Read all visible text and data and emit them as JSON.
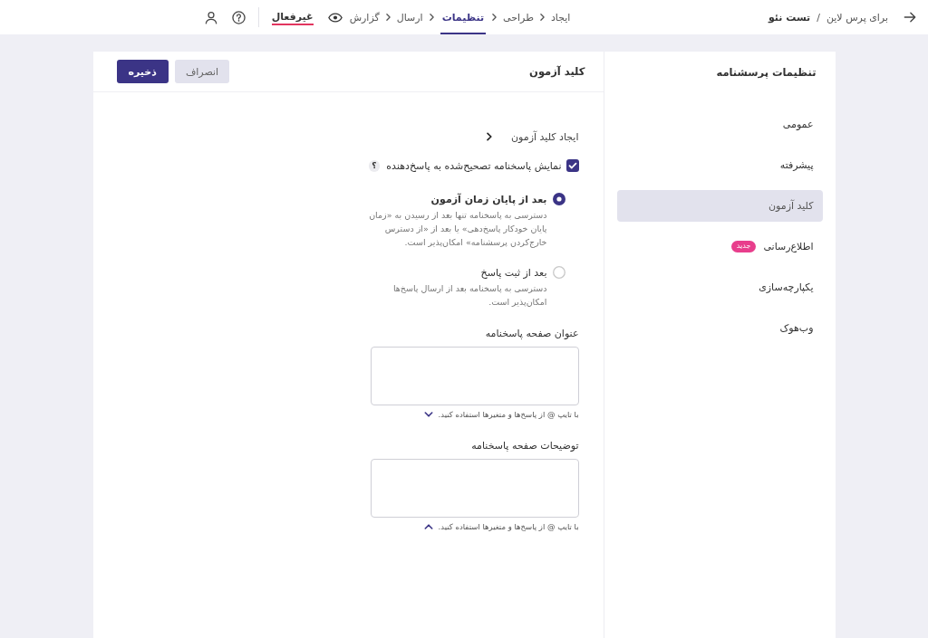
{
  "top_bar": {
    "project": {
      "parent": "برای پرس لاین",
      "separator": "/",
      "name": "تست نئو"
    },
    "steps": [
      {
        "label": "ایجاد",
        "selected": false
      },
      {
        "label": "طراحی",
        "selected": false
      },
      {
        "label": "تنظیمات",
        "selected": true
      },
      {
        "label": "ارسال",
        "selected": false
      },
      {
        "label": "گزارش",
        "selected": false
      }
    ],
    "status": "غیرفعال"
  },
  "sidebar": {
    "title": "تنظیمات پرسشنامه",
    "items": [
      {
        "label": "عمومی",
        "selected": false
      },
      {
        "label": "پیشرفته",
        "selected": false
      },
      {
        "label": "کلید آزمون",
        "selected": true
      },
      {
        "label": "اطلاع‌رسانی",
        "selected": false,
        "badge": "جدید"
      },
      {
        "label": "یکپارچه‌سازی",
        "selected": false
      },
      {
        "label": "وب‌هوک",
        "selected": false
      }
    ]
  },
  "panel": {
    "title": "کلید آزمون",
    "buttons": [
      {
        "label": "انصراف",
        "kind": "secondary"
      },
      {
        "label": "ذخیره",
        "kind": "primary"
      }
    ],
    "section": {
      "label": "ایجاد کلید آزمون"
    },
    "checkbox": {
      "label": "نمایش پاسخنامه تصحیح‌شده به پاسخ‌دهنده",
      "checked": true,
      "help": "؟"
    },
    "options": [
      {
        "label": "بعد از پایان زمان آزمون",
        "description": "دسترسی به پاسخنامه تنها بعد از رسیدن به «زمان پایان خودکار پاسخ‌دهی» یا بعد از «از دسترس خارج‌کردن پرسشنامه» امکان‌پذیر است.",
        "selected": true
      },
      {
        "label": "بعد از ثبت پاسخ",
        "description": "دسترسی به پاسخنامه بعد از ارسال پاسخ‌ها امکان‌پذیر است.",
        "selected": false
      }
    ],
    "fields": [
      {
        "label": "عنوان صفحه پاسخنامه",
        "hint": "با تایپ @ از پاسخ‌ها و متغیرها استفاده کنید.",
        "expanded": false
      },
      {
        "label": "توضیحات صفحه پاسخنامه",
        "hint": "با تایپ @ از پاسخ‌ها و متغیرها استفاده کنید.",
        "expanded": true
      }
    ]
  }
}
